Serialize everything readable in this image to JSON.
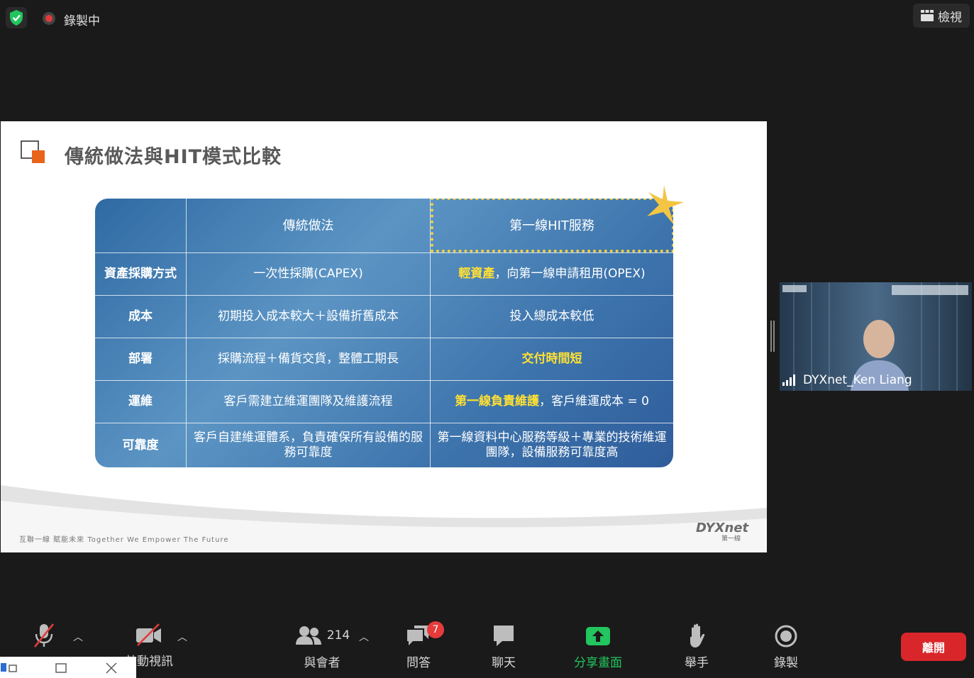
{
  "topbar": {
    "recording_label": "錄製中",
    "view_label": "檢視"
  },
  "slide": {
    "title": "傳統做法與HIT模式比較",
    "table": {
      "header": [
        "傳統做法",
        "第一線HIT服務"
      ],
      "rows": [
        {
          "label": "資產採購方式",
          "traditional": "一次性採購(CAPEX)",
          "hit_highlight": "輕資產",
          "hit_rest": "，向第一線申請租用(OPEX)"
        },
        {
          "label": "成本",
          "traditional": "初期投入成本較大＋設備折舊成本",
          "hit_highlight": "",
          "hit_rest": "投入總成本較低"
        },
        {
          "label": "部署",
          "traditional": "採購流程＋備貨交貨，整體工期長",
          "hit_highlight": "交付時間短",
          "hit_rest": ""
        },
        {
          "label": "運維",
          "traditional": "客戶需建立維運團隊及維護流程",
          "hit_highlight": "第一線負責維護",
          "hit_rest": "，客戶維運成本 = 0"
        },
        {
          "label": "可靠度",
          "traditional": "客戶自建維運體系，負責確保所有設備的服務可靠度",
          "hit_highlight": "",
          "hit_rest": "第一線資料中心服務等級＋專業的技術維運團隊，設備服務可靠度高"
        }
      ]
    },
    "footer_text": "互聯一線 賦能未來   Together We Empower The Future",
    "logo_text": "DYXnet",
    "logo_sub": "第一線"
  },
  "video": {
    "participant_name": "DYXnet_Ken Liang"
  },
  "toolbar": {
    "video_label": "啟動視訊",
    "participants_count": "214",
    "participants_label": "與會者",
    "qa_label": "問答",
    "qa_badge": "7",
    "chat_label": "聊天",
    "share_label": "分享畫面",
    "raise_hand_label": "舉手",
    "record_label": "錄製",
    "leave_label": "離開"
  },
  "colors": {
    "accent_green": "#22c55e",
    "leave_red": "#d9262b",
    "highlight_yellow": "#ffe033",
    "table_blue": "#3e75ad",
    "slide_orange": "#e8641b"
  }
}
